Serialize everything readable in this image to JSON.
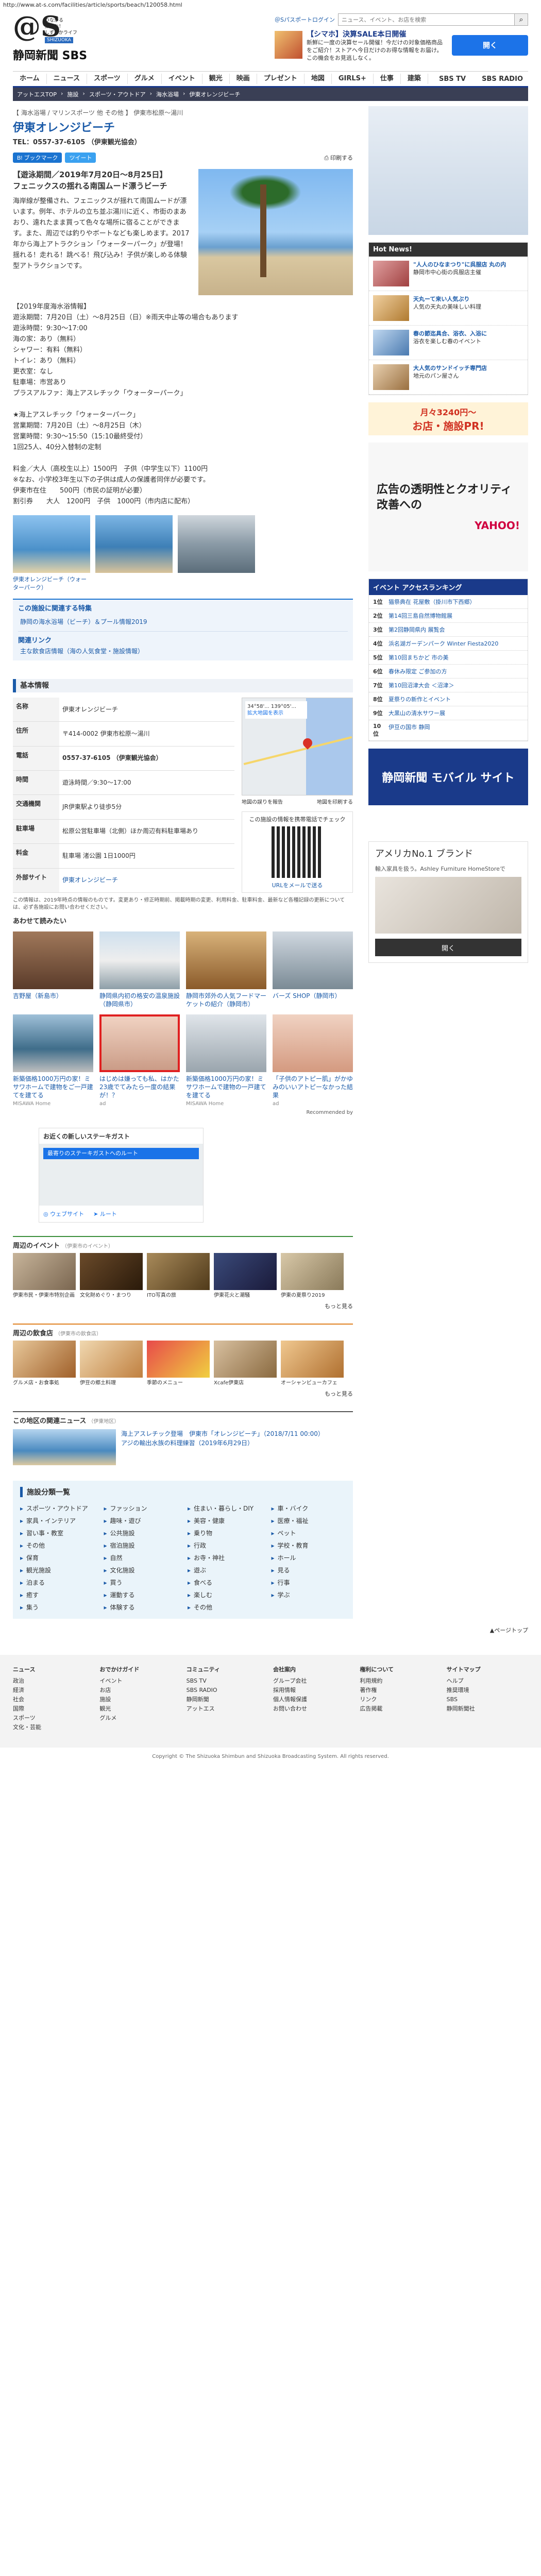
{
  "browser": {
    "url": "http://www.at-s.com/facilities/article/sports/beach/120058.html"
  },
  "header": {
    "logo": "@S",
    "tagline": "つながる\n楽しむ！\nしずおかライフ",
    "shizuoka": "SHIZUOKA",
    "brand": "静岡新聞 SBS",
    "login": "＠Sパスポートログイン",
    "search_placeholder": "ニュース、イベント、お店を検索",
    "ad_title": "【シマホ】決算SALE本日開催",
    "ad_text": "新鮮に一度の決算セール開催！今だけの対象価格商品をご紹介！ストアへ今日だけのお得な情報をお届け。この機会をお見逃しなく。",
    "ad_open": "開く"
  },
  "nav": {
    "items": [
      "ホーム",
      "ニュース",
      "スポーツ",
      "グルメ",
      "イベント",
      "観光",
      "映画",
      "プレゼント",
      "地図",
      "GIRLS+",
      "仕事",
      "建築"
    ],
    "tv": "SBS TV",
    "radio": "SBS RADIO"
  },
  "breadcrumb": [
    "アットエスTOP",
    "施設",
    "スポーツ・アウトドア",
    "海水浴場",
    "伊東オレンジビーチ"
  ],
  "article": {
    "category": "【 海水浴場 / マリンスポーツ 他 その他 】 伊東市松原～湯川",
    "title": "伊東オレンジビーチ",
    "tel": "TEL：0557-37-6105 （伊東観光協会）",
    "hatena": "B! ブックマーク",
    "tweet": "ツイート",
    "print": "印刷する",
    "lead": "【遊泳期間／2019年7月20日～8月25日】\nフェニックスの揺れる南国ムード漂うビーチ",
    "intro": "海岸線が整備され、フェニックスが揺れて南国ムードが漂います。例年、ホテルの立ち並ぶ湯川に近く、市街のまあおり、遠れたまま買って色々な場所に宿ることができます。また、周辺では釣りやボートなども楽しめます。2017年から海上アトラクション「ウォーターパーク」が登場！揺れる！走れる！跳べる！飛び込み！子供が楽しめる体験型アトラクションです。",
    "body": "【2019年度海水浴情報】\n遊泳期間：7月20日（土）～8月25日（日）※雨天中止等の場合もあります\n遊泳時間：9:30～17:00\n海の家：あり（無料）\nシャワー：有料（無料）\nトイレ：あり（無料）\n更衣室：なし\n駐車場：市営あり\nプラスアルファ：海上アスレチック「ウォーターパーク」\n\n★海上アスレチック「ウォーターパーク」\n営業期間：7月20日（土）～8月25日（木）\n営業時間：9:30～15:50（15:10最終受付）\n1回25人、40分入替制の定制\n\n料金／大人（高校生以上）1500円　子供（中学生以下）1100円\n※なお、小学校3年生以下の子供は成人の保護者同伴が必要です。\n伊東市在住　　500円（市民の証明が必要）\n割引券　　大人　1200円　子供　1000円（市内店に配布）",
    "gallery": [
      {
        "caption": "伊東オレンジビーチ（ウォーターパーク）"
      },
      {
        "caption": ""
      },
      {
        "caption": ""
      },
      {
        "caption": ""
      }
    ],
    "related_title": "この施設に関連する特集",
    "related_items": [
      "静岡の海水浴場（ビーチ）＆プール情報2019"
    ],
    "link_title": "関連リンク",
    "link_items": [
      "主な飲食店情報（海の人気食堂・施設情報）"
    ]
  },
  "basic_info": {
    "title": "基本情報",
    "rows": [
      {
        "th": "名称",
        "td": "伊東オレンジビーチ"
      },
      {
        "th": "住所",
        "td": "〒414-0002 伊東市松原～湯川"
      },
      {
        "th": "電話",
        "td": "0557-37-6105 （伊東観光協会）"
      },
      {
        "th": "時間",
        "td": "遊泳時間／9:30～17:00"
      },
      {
        "th": "交通機関",
        "td": "JR伊東駅より徒歩5分"
      },
      {
        "th": "駐車場",
        "td": "松原公営駐車場（北側）ほか周辺有料駐車場あり"
      },
      {
        "th": "料金",
        "td": "駐車場 渚公園 1日1000円"
      },
      {
        "th": "外部サイト",
        "td": "伊東オレンジビーチ"
      }
    ],
    "map_coord": "34°58'... 139°05'...",
    "map_link_large": "拡大地図を表示",
    "map_report": "地図の誤りを報告",
    "map_print": "地図を印刷する",
    "map_keyboard": "地図データ",
    "qr_title": "この施設の情報を携帯電話でチェック",
    "qr_link": "URLをメールで送る",
    "note": "この情報は、2019年時点の情報のものです。変更あり・修正時期前、掲載時期の変更、利用料金、駐車料金、最新など各種記録の更新については、必ず各施設にお問い合わせください。",
    "also": "あわせて読みたい"
  },
  "recommend": [
    {
      "title": "吉野屋（新島市）",
      "src": ""
    },
    {
      "title": "静岡県内初の格安の温泉施設（静岡県市）",
      "src": ""
    },
    {
      "title": "静岡市郊外の人気フードマーケットの紹介（静岡市）",
      "src": ""
    },
    {
      "title": "バーズ SHOP（静岡市）",
      "src": ""
    },
    {
      "title": "新築価格1000万円の家！ミサワホームで建物をご一戸建てを建てる",
      "src": "MISAWA Home"
    },
    {
      "title": "はじめは嫌っても私、はかた23歳でてみたら一度の結果が！？",
      "src": "ad"
    },
    {
      "title": "新築価格1000万円の家！ミサワホームで建物の一戸建てを建てる",
      "src": "MISAWA Home"
    },
    {
      "title": "「子供のアトピー肌」がかゆみのいいアトピーなかった結果",
      "src": "ad"
    }
  ],
  "recommend_foot": "Recommended by",
  "gmap_ad": {
    "title": "お近くの新しいステーキガスト",
    "bar": "最寄りのステーキガストへのルート",
    "route": "ルート",
    "web": "ウェブサイト"
  },
  "events_block": {
    "title": "周辺のイベント",
    "sub": "（伊東市のイベント）",
    "items": [
      "伊東市民・伊東市特別企画",
      "文化財めぐり・まつり",
      "ITO写真の旅",
      "伊東花火と潮騒",
      "伊東の夏祭り2019"
    ],
    "more": "もっと見る"
  },
  "gourmet_block": {
    "title": "周辺の飲食店",
    "sub": "（伊東市の飲食店）",
    "items": [
      "グルメ店・お食事処",
      "伊豆の郷土料理",
      "季節のメニュー",
      "Xcafe伊東店",
      "オーシャンビューカフェ"
    ],
    "more": "もっと見る"
  },
  "news_block": {
    "title": "この地区の関連ニュース",
    "sub": "（伊東地区）",
    "items": [
      "海上アスレチック登場　伊東市「オレンジビーチ」（2018/7/11 00:00）",
      "アジの輸出水族の料理練習（2019年6月29日）"
    ]
  },
  "facilities": {
    "title": "施設分類一覧",
    "items": [
      "スポーツ・アウトドア",
      "ファッション",
      "住まい・暮らし・DIY",
      "車・バイク",
      "家具・インテリア",
      "趣味・遊び",
      "美容・健康",
      "医療・福祉",
      "習い事・教室",
      "公共施設",
      "乗り物",
      "ペット",
      "その他",
      "宿泊施設",
      "行政",
      "学校・教育",
      "保育",
      "自然",
      "お寺・神社",
      "ホール",
      "観光施設",
      "文化施設",
      "遊ぶ",
      "見る",
      "泊まる",
      "買う",
      "食べる",
      "行事",
      "癒す",
      "運動する",
      "楽しむ",
      "学ぶ",
      "集う",
      "体験する",
      "その他"
    ]
  },
  "sidebar": {
    "login": "＠Sパスポートログイン",
    "hot_title": "Hot News!",
    "hot_items": [
      {
        "title": "\"人人のひなまつり\"に呉服店 丸の内",
        "desc": "静岡市中心街の呉服店主催"
      },
      {
        "title": "天丸ーて来い人気ぶり",
        "desc": "人気の天丸の美味しい料理"
      },
      {
        "title": "春の節迄具合、浴衣、入浴に",
        "desc": "浴衣を楽しむ春のイベント"
      },
      {
        "title": "大人気のサンドイッチ専門店",
        "desc": "地元のパン屋さん"
      }
    ],
    "banner1": "月々3240円〜",
    "banner1_sub": "お店・施設PR!",
    "ad2_title": "広告の透明性とクオリティ改善への",
    "ad2_sub": "YAHOO!",
    "rank_title": "イベント アクセスランキング",
    "rank": [
      {
        "n": "1位",
        "t": "猫祭典在 花屋敷（掛川市下西郷）"
      },
      {
        "n": "2位",
        "t": "第14回三島自然博物館展"
      },
      {
        "n": "3位",
        "t": "第2回静岡県内 展覧会"
      },
      {
        "n": "4位",
        "t": "浜名湖ガーデンパーク Winter Fiesta2020"
      },
      {
        "n": "5位",
        "t": "第10回まちかど 市の美"
      },
      {
        "n": "6位",
        "t": "春休み限定 ご参加の方"
      },
      {
        "n": "7位",
        "t": "第10回沼津大会 ＜沼津＞"
      },
      {
        "n": "8位",
        "t": "夏祭りの新作とイベント"
      },
      {
        "n": "9位",
        "t": "大黒山の清水サワー展"
      },
      {
        "n": "10位",
        "t": "伊豆の国市 静岡"
      }
    ],
    "mobile_banner": "静岡新聞 モバイル サイト",
    "ashley_title": "アメリカNo.1 ブランド",
    "ashley_text": "輸入家具を扱う。Ashley Furniture HomeStoreで",
    "ashley_open": "開く"
  },
  "footer": {
    "cols": [
      {
        "h": "ニュース",
        "items": [
          "政治",
          "経済",
          "社会",
          "国際",
          "スポーツ",
          "文化・芸能"
        ]
      },
      {
        "h": "おでかけガイド",
        "items": [
          "イベント",
          "お店",
          "施設",
          "観光",
          "グルメ"
        ]
      },
      {
        "h": "コミュニティ",
        "items": [
          "SBS TV",
          "SBS RADIO",
          "静岡新聞",
          "アットエス"
        ]
      },
      {
        "h": "会社案内",
        "items": [
          "グループ会社",
          "採用情報",
          "個人情報保護",
          "お問い合わせ"
        ]
      },
      {
        "h": "権利について",
        "items": [
          "利用規約",
          "著作権",
          "リンク",
          "広告掲載"
        ]
      },
      {
        "h": "サイトマップ",
        "items": [
          "ヘルプ",
          "推奨環境",
          "SBS",
          "静岡新聞社"
        ]
      }
    ],
    "pagetop": "▲ページトップ",
    "copyright": "Copyright © The Shizuoka Shimbun and Shizuoka Broadcasting System. All rights reserved."
  },
  "colors": {
    "brand": "#1a3a8a",
    "accent": "#1a5aa8",
    "hot": "#333333",
    "highlight": "#e02020"
  }
}
